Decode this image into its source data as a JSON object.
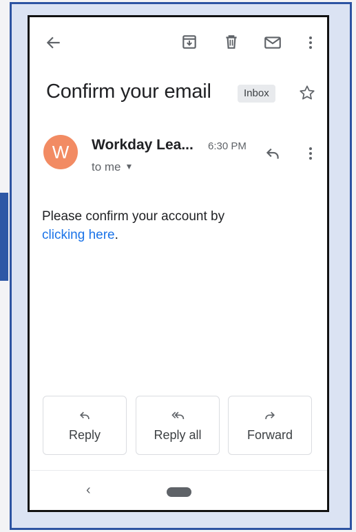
{
  "toolbar": {
    "back_icon": "arrow-left-icon",
    "archive_icon": "archive-icon",
    "delete_icon": "trash-icon",
    "mark_unread_icon": "mail-icon",
    "more_icon": "more-vert-icon"
  },
  "email": {
    "subject": "Confirm your email",
    "label": "Inbox",
    "starred": false,
    "sender_initial": "W",
    "sender_name": "Workday Lea...",
    "time": "6:30 PM",
    "recipient": "to me",
    "body_text": "Please confirm your account by",
    "link_text": "clicking here",
    "body_trailing": "."
  },
  "actions": {
    "reply": "Reply",
    "reply_all": "Reply all",
    "forward": "Forward"
  },
  "colors": {
    "avatar": "#f28b63",
    "link": "#1a73e8",
    "frame_border": "#2c53a2",
    "frame_bg": "#dbe3f3"
  }
}
